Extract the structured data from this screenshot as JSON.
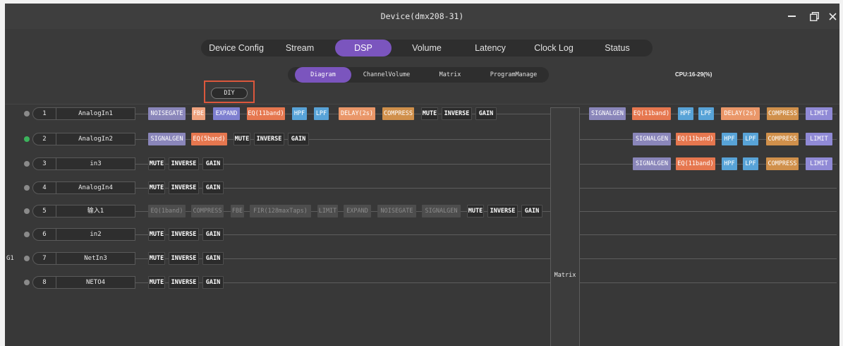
{
  "window": {
    "title": "Device(dmx208-31)"
  },
  "main_tabs": [
    {
      "label": "Device Config"
    },
    {
      "label": "Stream"
    },
    {
      "label": "DSP",
      "selected": true
    },
    {
      "label": "Volume"
    },
    {
      "label": "Latency"
    },
    {
      "label": "Clock Log"
    },
    {
      "label": "Status"
    }
  ],
  "sub_tabs": [
    {
      "label": "Diagram",
      "selected": true
    },
    {
      "label": "ChannelVolume"
    },
    {
      "label": "Matrix"
    },
    {
      "label": "ProgramManage"
    }
  ],
  "cpu": "CPU:16-29(%)",
  "diy_button": "DIY",
  "matrix_label": "Matrix",
  "inputs": [
    {
      "active": false,
      "number": "1",
      "name": "AnalogIn1",
      "modules": [
        "NOISEGATE",
        "FBE",
        "EXPAND",
        "EQ(11band)",
        "HPF",
        "LPF",
        "DELAY(2s)",
        "COMPRESS",
        "MUTE",
        "INVERSE",
        "GAIN"
      ]
    },
    {
      "active": true,
      "number": "2",
      "name": "AnalogIn2",
      "modules": [
        "SIGNALGEN",
        "EQ(5band)",
        "MUTE",
        "INVERSE",
        "GAIN"
      ]
    },
    {
      "active": false,
      "number": "3",
      "name": "in3",
      "modules": [
        "MUTE",
        "INVERSE",
        "GAIN"
      ]
    },
    {
      "active": false,
      "number": "4",
      "name": "AnalogIn4",
      "modules": [
        "MUTE",
        "INVERSE",
        "GAIN"
      ]
    },
    {
      "active": false,
      "number": "5",
      "name": "输入1",
      "modules_disabled": [
        "EQ(1band)",
        "COMPRESS",
        "FBE",
        "FIR(128maxTaps)",
        "LIMIT",
        "EXPAND",
        "NOISEGATE",
        "SIGNALGEN"
      ],
      "modules": [
        "MUTE",
        "INVERSE",
        "GAIN"
      ]
    },
    {
      "active": false,
      "number": "6",
      "name": "in2",
      "modules": [
        "MUTE",
        "INVERSE",
        "GAIN"
      ]
    },
    {
      "active": false,
      "group": "G1",
      "number": "7",
      "name": "NetIn3",
      "modules": [
        "MUTE",
        "INVERSE",
        "GAIN"
      ]
    },
    {
      "active": false,
      "number": "8",
      "name": "NETO4",
      "modules": [
        "MUTE",
        "INVERSE",
        "GAIN"
      ]
    }
  ],
  "outputs": [
    {
      "modules": [
        "SIGNALGEN",
        "EQ(11band)",
        "HPF",
        "LPF",
        "DELAY(2s)",
        "COMPRESS",
        "LIMIT"
      ]
    },
    {
      "modules": [
        "SIGNALGEN",
        "EQ(11band)",
        "HPF",
        "LPF",
        "COMPRESS",
        "LIMIT"
      ]
    },
    {
      "modules": [
        "SIGNALGEN",
        "EQ(11band)",
        "HPF",
        "LPF",
        "COMPRESS",
        "LIMIT"
      ]
    }
  ],
  "colors": {
    "accent": "#7b55be",
    "signalgen": "#8a86ba",
    "noisegate": "#8a86ba",
    "fbe": "#eea27e",
    "expand": "#7e7fd0",
    "eq": "#e6774f",
    "filter": "#58a3d7",
    "delay": "#ea9769",
    "compress": "#d0904b",
    "limit": "#908ad6",
    "active_dot": "#3cb35c",
    "highlight": "#db573c"
  },
  "icons": {
    "minimize": "minimize-icon",
    "restore": "restore-icon",
    "close": "close-icon"
  }
}
